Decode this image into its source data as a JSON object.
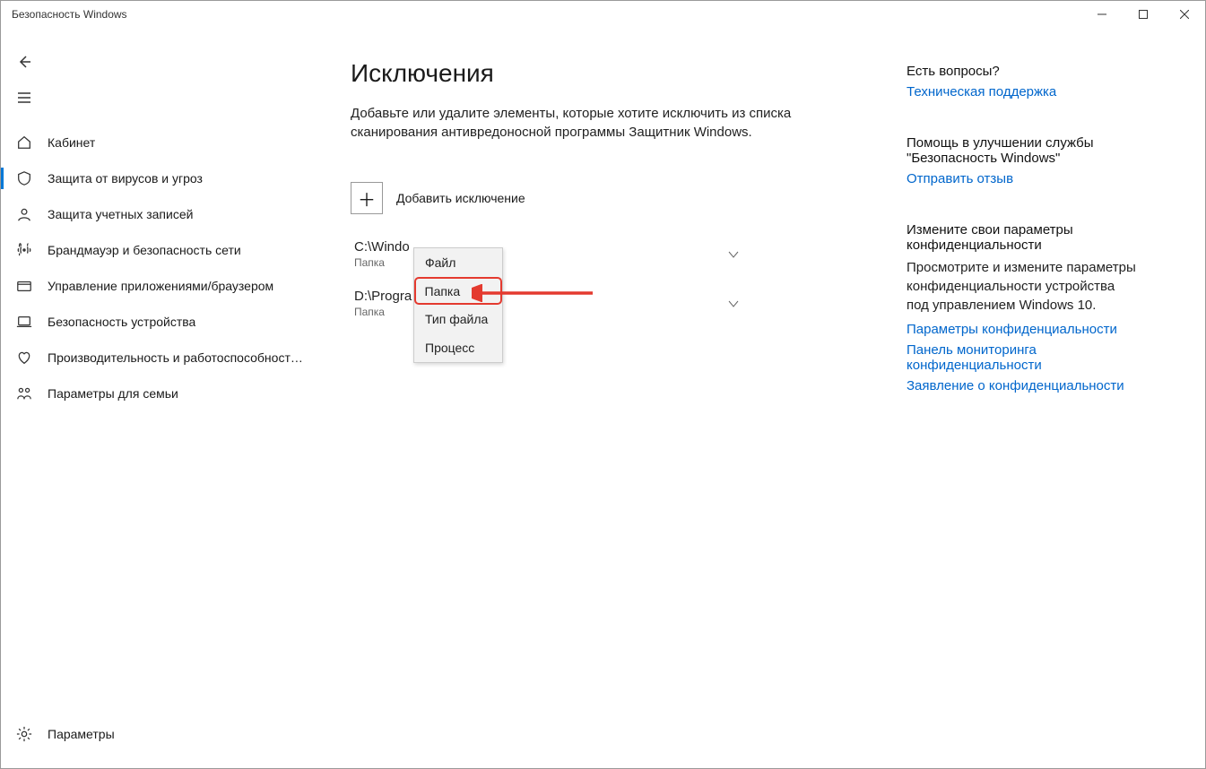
{
  "window": {
    "title": "Безопасность Windows"
  },
  "sidebar": {
    "items": [
      {
        "label": "Кабинет"
      },
      {
        "label": "Защита от вирусов и угроз"
      },
      {
        "label": "Защита учетных записей"
      },
      {
        "label": "Брандмауэр и безопасность сети"
      },
      {
        "label": "Управление приложениями/браузером"
      },
      {
        "label": "Безопасность устройства"
      },
      {
        "label": "Производительность и работоспособность устройства"
      },
      {
        "label": "Параметры для семьи"
      }
    ],
    "settings_label": "Параметры"
  },
  "content": {
    "heading": "Исключения",
    "description": "Добавьте или удалите элементы, которые хотите исключить из списка сканирования антивредоносной программы Защитник Windows.",
    "add_label": "Добавить исключение",
    "exclusions": [
      {
        "path": "C:\\Windo",
        "kind": "Папка"
      },
      {
        "path": "D:\\Progra",
        "kind": "Папка"
      }
    ],
    "popup": {
      "items": [
        "Файл",
        "Папка",
        "Тип файла",
        "Процесс"
      ]
    }
  },
  "help": {
    "sections": [
      {
        "title": "Есть вопросы?",
        "links": [
          "Техническая поддержка"
        ]
      },
      {
        "title": "Помощь в улучшении службы \"Безопасность Windows\"",
        "links": [
          "Отправить отзыв"
        ]
      },
      {
        "title": "Измените свои параметры конфиденциальности",
        "text": "Просмотрите и измените параметры конфиденциальности устройства под управлением Windows 10.",
        "links": [
          "Параметры конфиденциальности",
          "Панель мониторинга конфиденциальности",
          "Заявление о конфиденциальности"
        ]
      }
    ]
  },
  "icons": {
    "plus": "＋"
  }
}
